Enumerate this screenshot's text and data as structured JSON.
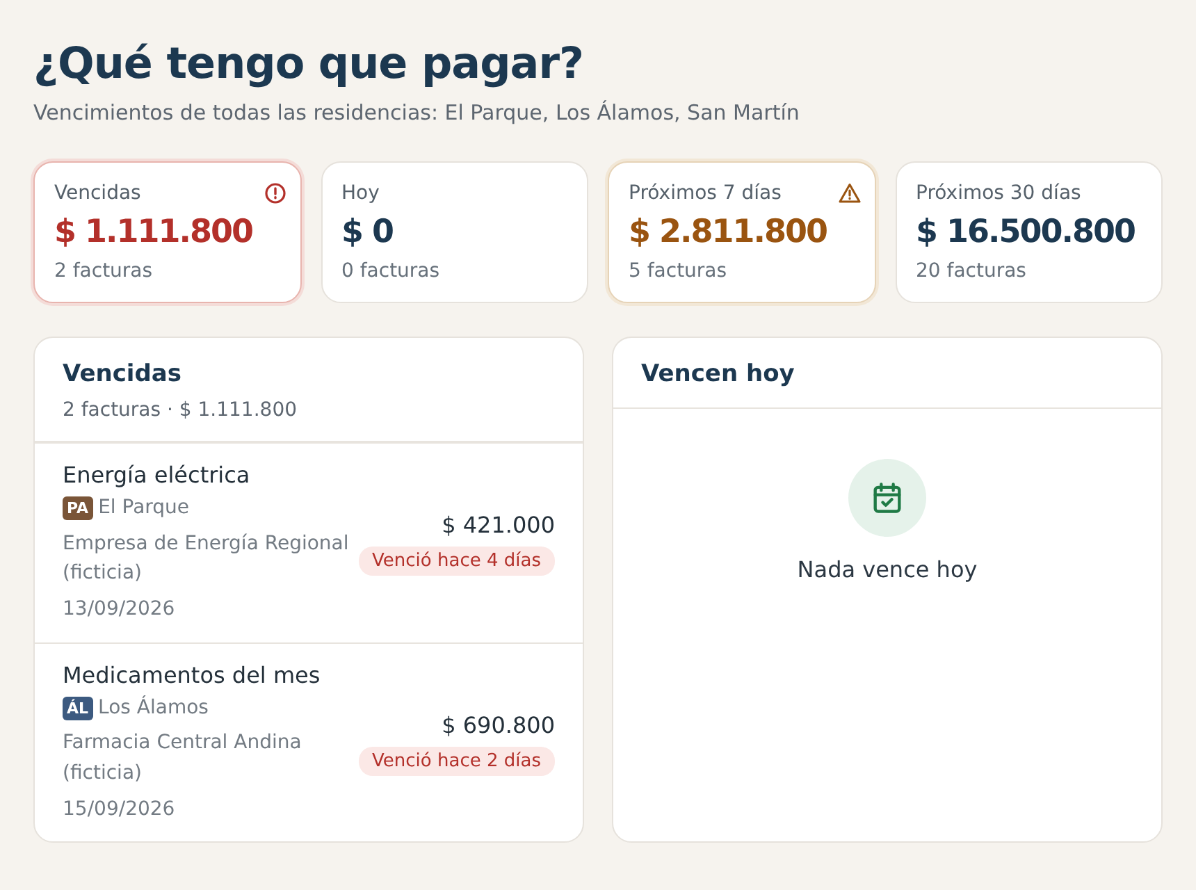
{
  "header": {
    "title": "¿Qué tengo que pagar?",
    "subtitle": "Vencimientos de todas las residencias: El Parque, Los Álamos, San Martín"
  },
  "stats": [
    {
      "label": "Vencidas",
      "amount": "$ 1.111.800",
      "count": "2 facturas",
      "kind": "danger"
    },
    {
      "label": "Hoy",
      "amount": "$ 0",
      "count": "0 facturas",
      "kind": "neutral"
    },
    {
      "label": "Próximos 7 días",
      "amount": "$ 2.811.800",
      "count": "5 facturas",
      "kind": "warning"
    },
    {
      "label": "Próximos 30 días",
      "amount": "$ 16.500.800",
      "count": "20 facturas",
      "kind": "neutral"
    }
  ],
  "overdue": {
    "title": "Vencidas",
    "summary": "2 facturas · $ 1.111.800",
    "bills": [
      {
        "name": "Energía eléctrica",
        "badge": "PA",
        "color": "#7a5538",
        "residence": "El Parque",
        "provider": "Empresa de Energía Regional (ficticia)",
        "date": "13/09/2026",
        "amount": "$ 421.000",
        "status": "Venció hace 4 días"
      },
      {
        "name": "Medicamentos del mes",
        "badge": "ÁL",
        "color": "#3c5a80",
        "residence": "Los Álamos",
        "provider": "Farmacia Central Andina (ficticia)",
        "date": "15/09/2026",
        "amount": "$ 690.800",
        "status": "Venció hace 2 días"
      }
    ]
  },
  "today": {
    "title": "Vencen hoy",
    "empty": "Nada vence hoy"
  }
}
